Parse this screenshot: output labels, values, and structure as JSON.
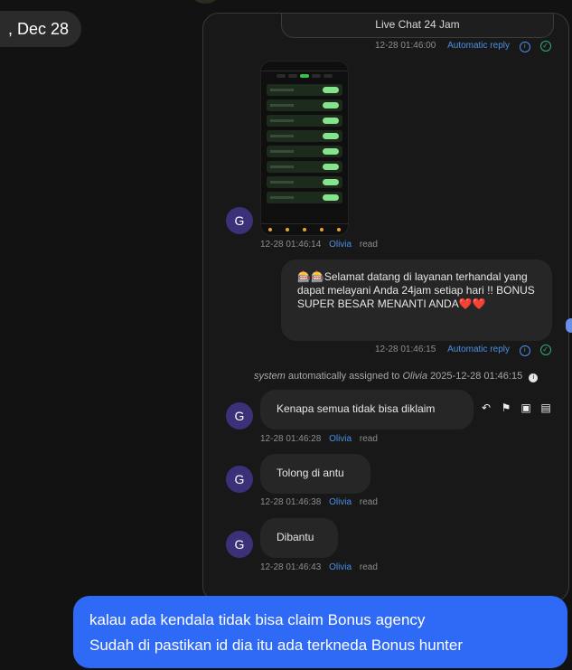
{
  "date_pill": ", Dec 28",
  "live_chat": "Live Chat 24 Jam",
  "messages": [
    {
      "time": "12-28 01:46:00",
      "tag": "Automatic reply"
    },
    {
      "time": "12-28 01:46:14",
      "author": "Olivia",
      "status": "read"
    },
    {
      "text": "🎰🎰Selamat datang di layanan terhandal yang dapat melayani Anda 24jam setiap hari !! BONUS SUPER BESAR MENANTI ANDA❤️❤️",
      "time": "12-28 01:46:15",
      "tag": "Automatic reply"
    },
    {
      "system": "automatically assigned to",
      "system_prefix": "system",
      "system_user": "Olivia",
      "system_time": "2025-12-28 01:46:15"
    },
    {
      "text": "Kenapa semua tidak bisa diklaim",
      "time": "12-28 01:46:28",
      "author": "Olivia",
      "status": "read"
    },
    {
      "text": "Tolong di antu",
      "time": "12-28 01:46:38",
      "author": "Olivia",
      "status": "read"
    },
    {
      "text": "Dibantu",
      "time": "12-28 01:46:43",
      "author": "Olivia",
      "status": "read"
    }
  ],
  "avatar_letter": "G",
  "bottom_message": {
    "line1": "kalau ada kendala tidak bisa claim Bonus agency",
    "line2": "Sudah di pastikan id dia itu ada terkneda Bonus hunter"
  },
  "icons": [
    "reply-icon",
    "flag-icon",
    "comment-icon",
    "bookmark-icon",
    "info-icon",
    "check-icon"
  ]
}
